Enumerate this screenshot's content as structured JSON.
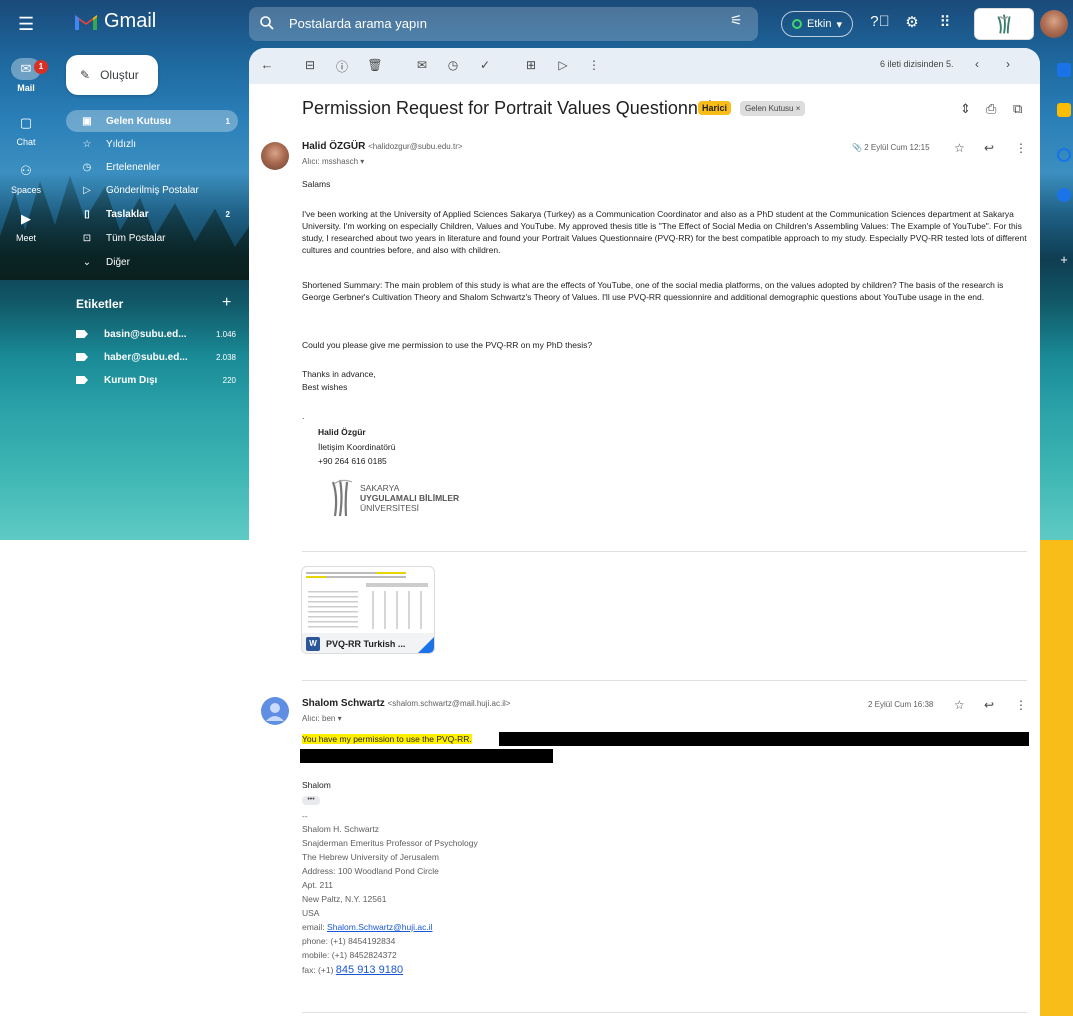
{
  "header": {
    "app_name": "Gmail",
    "search_placeholder": "Postalarda arama yapın",
    "status_label": "Etkin"
  },
  "rail": [
    {
      "label": "Mail",
      "icon": "mail-icon",
      "badge": "1"
    },
    {
      "label": "Chat",
      "icon": "chat-icon"
    },
    {
      "label": "Spaces",
      "icon": "spaces-icon"
    },
    {
      "label": "Meet",
      "icon": "meet-icon"
    }
  ],
  "compose_label": "Oluştur",
  "nav": [
    {
      "label": "Gelen Kutusu",
      "count": "1",
      "icon": "inbox-icon"
    },
    {
      "label": "Yıldızlı",
      "count": "",
      "icon": "star-icon"
    },
    {
      "label": "Ertelenenler",
      "count": "",
      "icon": "clock-icon"
    },
    {
      "label": "Gönderilmiş Postalar",
      "count": "",
      "icon": "send-icon"
    },
    {
      "label": "Taslaklar",
      "count": "2",
      "icon": "draft-icon"
    },
    {
      "label": "Tüm Postalar",
      "count": "",
      "icon": "all-mail-icon"
    },
    {
      "label": "Diğer",
      "count": "",
      "icon": "chevron-down-icon"
    }
  ],
  "labels_title": "Etiketler",
  "labels": [
    {
      "name": "basin@subu.ed...",
      "count": "1.046"
    },
    {
      "name": "haber@subu.ed...",
      "count": "2.038"
    },
    {
      "name": "Kurum Dışı",
      "count": "220"
    }
  ],
  "toolbar": {
    "pager": "6 ileti dizisinden 5."
  },
  "thread": {
    "subject": "Permission Request for Portrait Values Questionnaire",
    "chip_external": "Harici",
    "chip_inbox": "Gelen Kutusu ×"
  },
  "msg1": {
    "sender": "Halid ÖZGÜR",
    "email": "<halidozgur@subu.edu.tr>",
    "to": "Alıcı: msshasch ▾",
    "date": "2 Eylül Cum 12:15",
    "greeting": "Salams",
    "p1": "I've been working at the University of Applied Sciences Sakarya (Turkey) as a Communication Coordinator and also as a PhD student  at the Communication Sciences department at Sakarya University. I'm working on especially Children, Values and YouTube. My approved thesis title is \"The Effect of Social Media on Children's Assembling Values: The Example of YouTube\". For this study, I researched about two years in literature and found your Portrait Values Questionnaire (PVQ-RR) for the best compatible approach to my study. Especially PVQ-RR tested lots of different cultures and countries before, and also with children.",
    "p2": "Shortened Summary: The main problem of this study is what are the effects of YouTube, one of the social media platforms, on the values adopted by children? The basis of the research is George Gerbner's Cultivation Theory and Shalom Schwartz's Theory of Values. I'll use PVQ-RR quessionnire and additional demographic questions about YouTube usage in the end.",
    "p3": "Could you please give me permission to use the PVQ-RR on my PhD thesis?",
    "closing1": "Thanks in advance,",
    "closing2": "Best wishes",
    "sig_dot": ".",
    "sig_name": "Halid Özgür",
    "sig_title": "İletişim Koordinatörü",
    "sig_phone": "+90 264 616 0185",
    "logo_l1": "SAKARYA",
    "logo_l2": "UYGULAMALI BİLİMLER",
    "logo_l3": "ÜNİVERSİTESİ",
    "attachment": "PVQ-RR Turkish ..."
  },
  "msg2": {
    "sender": "Shalom Schwartz",
    "email": "<shalom.schwartz@mail.huji.ac.il>",
    "to": "Alıcı: ben ▾",
    "date": "2 Eylül Cum 16:38",
    "highlight": "You have my permission to use the PVQ-RR.",
    "signoff": "Shalom",
    "dashes": "--",
    "sig": [
      "Shalom H. Schwartz",
      "Snajderman Emeritus Professor of Psychology",
      "The Hebrew University of Jerusalem",
      "Address: 100 Woodland Pond Circle",
      "Apt. 211",
      "New Paltz, N.Y. 12561",
      "USA"
    ],
    "email_label": "email: ",
    "email_link": "Shalom.Schwartz@huji.ac.il",
    "phone": "phone: (+1) 8454192834",
    "mobile": "mobile: (+1) 8452824372",
    "fax_label": "fax: (+1) ",
    "fax_link": "845 913 9180"
  },
  "colors": {
    "accent_yellow": "#f9bd19",
    "link": "#1a57d4",
    "badge_red": "#d93025"
  }
}
